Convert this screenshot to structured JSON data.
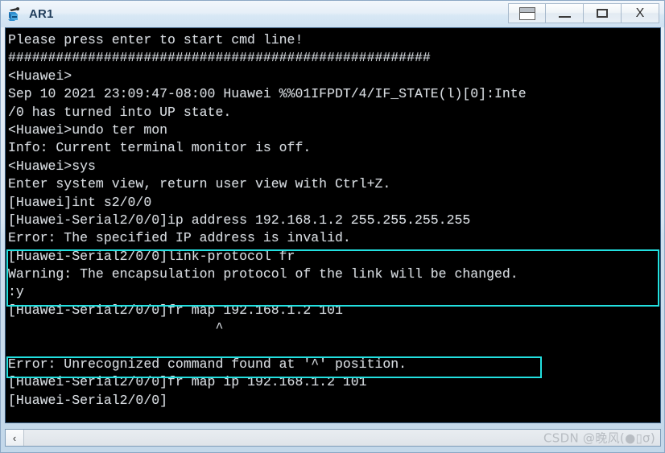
{
  "window": {
    "title": "AR1",
    "icon": "router-icon",
    "buttons": [
      {
        "name": "restore-window-button",
        "label": "",
        "icon": "restore-icon"
      },
      {
        "name": "minimize-window-button",
        "label": "",
        "icon": "minimize-icon"
      },
      {
        "name": "maximize-window-button",
        "label": "",
        "icon": "maximize-icon"
      },
      {
        "name": "close-window-button",
        "label": "X",
        "icon": "close-icon"
      }
    ]
  },
  "terminal": {
    "background": "#000000",
    "foreground": "#d8dce0",
    "highlight_color": "#22e0e0",
    "lines": [
      "Please press enter to start cmd line!",
      "#####################################################",
      "<Huawei>",
      "Sep 10 2021 23:09:47-08:00 Huawei %%01IFPDT/4/IF_STATE(l)[0]:Inte",
      "/0 has turned into UP state.",
      "<Huawei>undo ter mon",
      "Info: Current terminal monitor is off.",
      "<Huawei>sys",
      "Enter system view, return user view with Ctrl+Z.",
      "[Huawei]int s2/0/0",
      "[Huawei-Serial2/0/0]ip address 192.168.1.2 255.255.255.255",
      "Error: The specified IP address is invalid.",
      "[Huawei-Serial2/0/0]link-protocol fr",
      "Warning: The encapsulation protocol of the link will be changed.",
      ":y",
      "[Huawei-Serial2/0/0]fr map 192.168.1.2 101",
      "                          ^",
      "",
      "Error: Unrecognized command found at '^' position.",
      "[Huawei-Serial2/0/0]fr map ip 192.168.1.2 101",
      "[Huawei-Serial2/0/0]"
    ],
    "highlights": [
      {
        "name": "highlight-link-protocol",
        "first_line": 12,
        "last_line": 14
      },
      {
        "name": "highlight-fr-map-ip",
        "first_line": 19,
        "last_line": 19
      }
    ]
  },
  "scrollbar": {
    "left_arrow": "‹",
    "watermark": "CSDN @晚风(●▯σ)"
  }
}
